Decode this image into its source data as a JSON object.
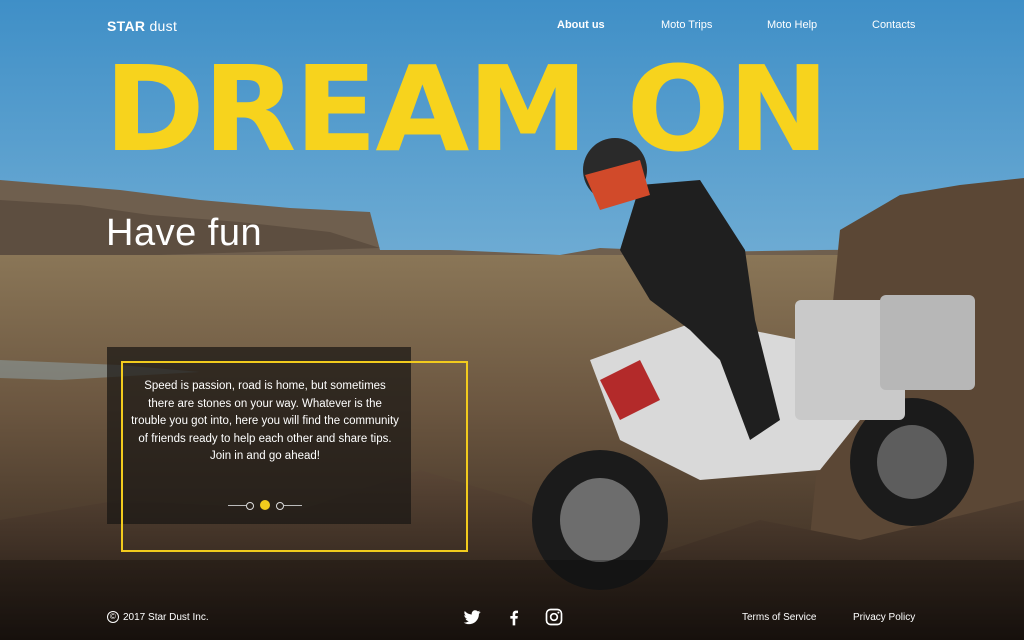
{
  "brand": {
    "strong": "STAR",
    "light": " dust"
  },
  "nav": {
    "items": [
      {
        "label": "About us",
        "active": true
      },
      {
        "label": "Moto Trips",
        "active": false
      },
      {
        "label": "Moto Help",
        "active": false
      },
      {
        "label": "Contacts",
        "active": false
      }
    ]
  },
  "hero": {
    "headline": "DREAM ON",
    "subheadline": "Have fun",
    "accent_color": "#f7d31d"
  },
  "card": {
    "text": "Speed is passion, road is home, but sometimes there are stones on your way. Whatever is the trouble you got into, here you will find the community of friends ready to help each other and share tips. Join in and go ahead!",
    "slider": {
      "total": 3,
      "active_index": 1
    }
  },
  "footer": {
    "copyright": "2017 Star Dust Inc.",
    "socials": [
      "twitter-icon",
      "facebook-icon",
      "instagram-icon"
    ],
    "links": [
      "Terms of Service",
      "Privacy Policy"
    ]
  }
}
